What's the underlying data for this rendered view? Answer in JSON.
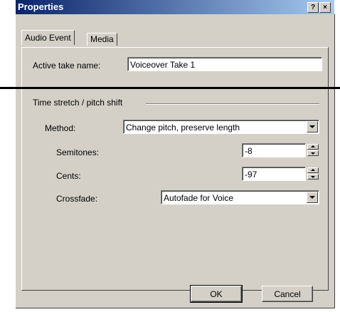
{
  "window": {
    "title": "Properties",
    "help_button": "?",
    "close_button": "×"
  },
  "tabs": [
    {
      "label": "Audio Event",
      "active": true
    },
    {
      "label": "Media",
      "active": false
    }
  ],
  "active_take": {
    "label": "Active take name:",
    "value": "Voiceover Take 1"
  },
  "group": {
    "label": "Time stretch / pitch shift"
  },
  "method": {
    "label": "Method:",
    "value": "Change pitch, preserve length"
  },
  "semitones": {
    "label": "Semitones:",
    "value": "-8"
  },
  "cents": {
    "label": "Cents:",
    "value": "-97"
  },
  "crossfade": {
    "label": "Crossfade:",
    "value": "Autofade for Voice"
  },
  "buttons": {
    "ok": "OK",
    "cancel": "Cancel"
  }
}
